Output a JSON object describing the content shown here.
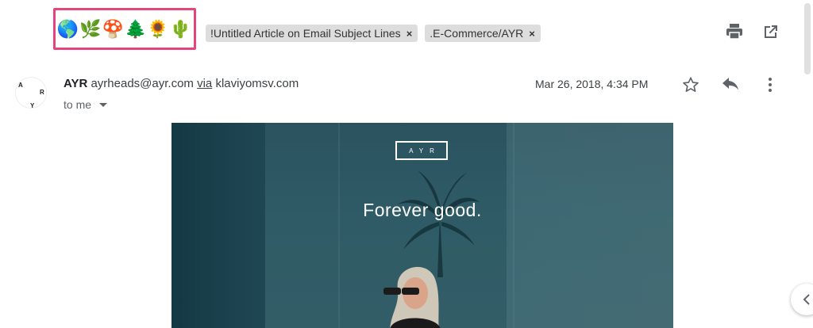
{
  "subject": {
    "emoji": "🌎🌿🍄🌲🌻🌵"
  },
  "labels": [
    {
      "text": "!Untitled Article on Email Subject Lines",
      "remove": "×"
    },
    {
      "text": ".E-Commerce/AYR",
      "remove": "×"
    }
  ],
  "toolbar": {
    "print_icon": "print-icon",
    "popout_icon": "open-in-new-window-icon"
  },
  "message": {
    "avatar": {
      "a": "A",
      "r": "R",
      "y": "Y"
    },
    "sender_name": "AYR",
    "sender_email": "ayrheads@ayr.com",
    "via_label": "via",
    "via_domain": "klaviyomsv.com",
    "recipient": "to me",
    "date": "Mar 26, 2018, 4:34 PM"
  },
  "email_body": {
    "logo": "AYR",
    "tagline": "Forever good."
  },
  "colors": {
    "highlight_border": "#e5457c",
    "label_bg": "#dddddd"
  }
}
